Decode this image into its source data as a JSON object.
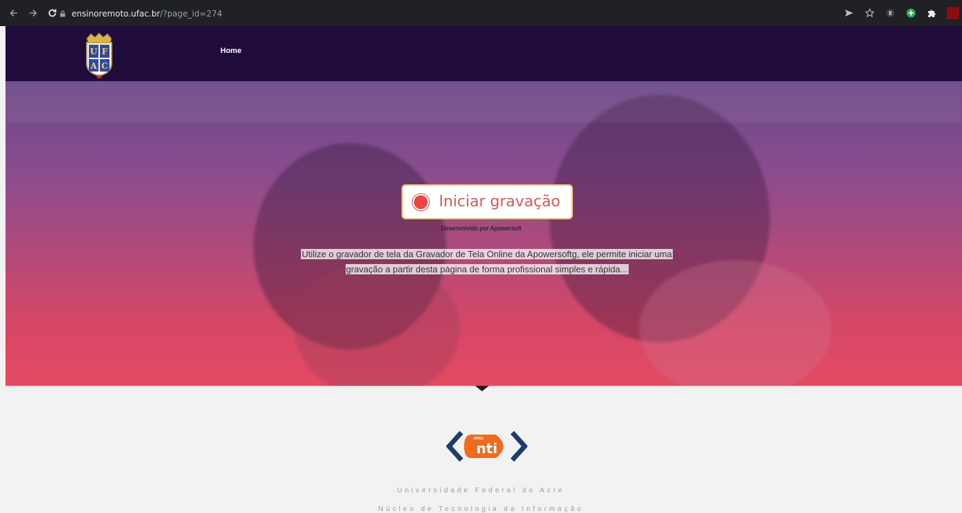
{
  "browser": {
    "url_host": "ensinoremoto.ufac.br",
    "url_path": "/?page_id=274"
  },
  "header": {
    "logo_alt": "UFAC",
    "nav": [
      {
        "label": "Home"
      }
    ]
  },
  "hero": {
    "record_button_label": "Iniciar gravação",
    "developed_by": "Desenvolvido por Apowersoft",
    "description_line1": "Utilize o gravador de tela da Gravador de Tela Online da Apowersoftg, ele permite iniciar uma",
    "description_line2": "gravação a partir desta página de forma profissional simples e rápida..."
  },
  "footer": {
    "nti_badge": "UFAC",
    "nti_text": "nti",
    "line1": "Universidade Federal do Acre",
    "line2": "Núcleo de Tecnologia da Informação"
  },
  "colors": {
    "header_bg": "#1f0c3a",
    "record_red": "#ef4444",
    "record_border": "#f5c26b",
    "nti_orange": "#f26a1b",
    "nti_navy": "#1f3d6b"
  }
}
